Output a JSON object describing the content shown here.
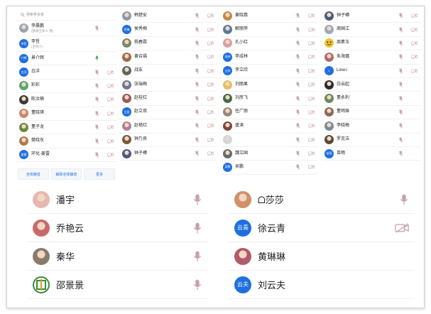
{
  "panel1": {
    "search_placeholder": "搜索参会者",
    "rows": [
      {
        "name": "李晨鹏",
        "sub": "(我将全体人 我)",
        "avatar": "photo",
        "color": "#9aa6b2",
        "badge": "",
        "mic": "muted",
        "cam": false
      },
      {
        "name": "李哲",
        "sub": "(主持人)",
        "avatar": "text",
        "color": "#1f6fe0",
        "badge": "李哲",
        "mic": "none",
        "cam": false
      },
      {
        "name": "景介辉",
        "sub": "",
        "avatar": "text",
        "color": "#1f6fe0",
        "badge": "介辉",
        "mic": "on",
        "cam": false
      },
      {
        "name": "白洋",
        "sub": "",
        "avatar": "text",
        "color": "#1f6fe0",
        "badge": "白洋",
        "mic": "muted",
        "cam": true
      },
      {
        "name": "彩彩",
        "sub": "",
        "avatar": "photo",
        "color": "#58a86b",
        "badge": "",
        "mic": "muted",
        "cam": true
      },
      {
        "name": "陈汝楠",
        "sub": "",
        "avatar": "photo",
        "color": "#3a3a3a",
        "badge": "",
        "mic": "muted",
        "cam": true
      },
      {
        "name": "董晓琪",
        "sub": "",
        "avatar": "photo",
        "color": "#c9856a",
        "badge": "",
        "mic": "muted",
        "cam": true
      },
      {
        "name": "董子龙",
        "sub": "",
        "avatar": "photo",
        "color": "#6c8a3c",
        "badge": "",
        "mic": "muted",
        "cam": true
      },
      {
        "name": "樊晓东",
        "sub": "",
        "avatar": "photo",
        "color": "#b07a4a",
        "badge": "",
        "mic": "muted",
        "cam": true
      },
      {
        "name": "环化-姜雷",
        "sub": "",
        "avatar": "text",
        "color": "#1f6fe0",
        "badge": "姜雷",
        "mic": "muted",
        "cam": true
      }
    ],
    "buttons": [
      "全体静音",
      "解除全体静音",
      "更多"
    ]
  },
  "panel2": {
    "rows": [
      {
        "name": "韩楚安",
        "avatar": "photo",
        "color": "#8f9aa8",
        "badge": ""
      },
      {
        "name": "侯秀梅",
        "avatar": "text",
        "color": "#1f6fe0",
        "badge": "秀梅"
      },
      {
        "name": "杨春霞",
        "avatar": "photo",
        "color": "#7a8a6a",
        "badge": ""
      },
      {
        "name": "黄召福",
        "avatar": "photo",
        "color": "#a06a4a",
        "badge": ""
      },
      {
        "name": "战友",
        "avatar": "photo",
        "color": "#5a6a5a",
        "badge": ""
      },
      {
        "name": "张瑞梅",
        "avatar": "photo",
        "color": "#6a7a9a",
        "badge": ""
      },
      {
        "name": "赵桂红",
        "avatar": "photo",
        "color": "#9a5a5a",
        "badge": ""
      },
      {
        "name": "赵立双",
        "avatar": "text",
        "color": "#1f6fe0",
        "badge": "立双"
      },
      {
        "name": "赵艳红",
        "avatar": "photo",
        "color": "#b0809a",
        "badge": ""
      },
      {
        "name": "钟乃良",
        "avatar": "photo",
        "color": "#7a5a3a",
        "badge": ""
      },
      {
        "name": "钟子樽",
        "avatar": "photo",
        "color": "#4a5a7a",
        "badge": ""
      }
    ]
  },
  "panel3": {
    "rows": [
      {
        "name": "黄晓惠",
        "avatar": "photo",
        "color": "#c08a4a",
        "badge": ""
      },
      {
        "name": "解丽萍",
        "avatar": "photo",
        "color": "#5a7a9a",
        "badge": ""
      },
      {
        "name": "孔小红",
        "avatar": "photo",
        "color": "#d9a0a0",
        "badge": ""
      },
      {
        "name": "李成林",
        "avatar": "text",
        "color": "#1f6fe0",
        "badge": "成林"
      },
      {
        "name": "李立欣",
        "avatar": "text",
        "color": "#1f6fe0",
        "badge": "立欣"
      },
      {
        "name": "刘丽果",
        "avatar": "photo",
        "color": "#e0c060",
        "badge": ""
      },
      {
        "name": "刘彦飞",
        "avatar": "photo",
        "color": "#4a6a4a",
        "badge": ""
      },
      {
        "name": "任广丽",
        "avatar": "photo",
        "color": "#9a8a7a",
        "badge": ""
      },
      {
        "name": "盛涛",
        "avatar": "photo",
        "color": "#7a4a3a",
        "badge": ""
      },
      {
        "name": "",
        "avatar": "photo",
        "color": "#cfd6de",
        "badge": ""
      },
      {
        "name": "魏立国",
        "avatar": "photo",
        "color": "#6a6a6a",
        "badge": ""
      },
      {
        "name": "吴鹏",
        "avatar": "text",
        "color": "#1f6fe0",
        "badge": "吴鹏"
      }
    ]
  },
  "panel4": {
    "rows": [
      {
        "name": "钟子樽",
        "avatar": "photo",
        "color": "#4a5a7a",
        "badge": "",
        "cam": true
      },
      {
        "name": "周国江",
        "avatar": "photo",
        "color": "#9aaabb",
        "badge": "",
        "cam": true
      },
      {
        "name": "周素玉",
        "avatar": "emoji",
        "color": "#f2c230",
        "badge": "",
        "cam": true
      },
      {
        "name": "朱海璐",
        "avatar": "photo",
        "color": "#b06a6a",
        "badge": "",
        "cam": true
      },
      {
        "name": "Lixw√",
        "avatar": "text",
        "color": "#1f6fe0",
        "badge": "L",
        "cam": true
      },
      {
        "name": "白云起",
        "avatar": "photo",
        "color": "#2a2a2a",
        "badge": "",
        "cam": false
      },
      {
        "name": "董永利",
        "avatar": "photo",
        "color": "#6a8a5a",
        "badge": "",
        "cam": false
      },
      {
        "name": "董明珠",
        "avatar": "photo",
        "color": "#8a6a5a",
        "badge": "",
        "cam": false
      },
      {
        "name": "李晓梅",
        "avatar": "photo",
        "color": "#7a8aa0",
        "badge": "",
        "cam": false
      },
      {
        "name": "罗克洁",
        "avatar": "photo",
        "color": "#5a4a3a",
        "badge": "",
        "cam": false
      },
      {
        "name": "苗雨",
        "avatar": "text",
        "color": "#1f6fe0",
        "badge": "苗雨",
        "cam": false
      }
    ]
  },
  "bottom_left": {
    "rows": [
      {
        "name": "潘宇",
        "avatar": "photo",
        "color": "#e7b7b0",
        "badge": ""
      },
      {
        "name": "乔艳云",
        "avatar": "photo",
        "color": "#c86a6a",
        "badge": ""
      },
      {
        "name": "秦华",
        "avatar": "photo",
        "color": "#8a7a6a",
        "badge": ""
      },
      {
        "name": "邵景景",
        "avatar": "logo",
        "color": "#3a8a3a",
        "badge": ""
      }
    ]
  },
  "bottom_right": {
    "rows": [
      {
        "name": "ᗝ莎莎",
        "avatar": "photo",
        "color": "#d0906a",
        "badge": "",
        "icon": "mic"
      },
      {
        "name": "徐云青",
        "avatar": "text",
        "color": "#1f6fe0",
        "badge": "云青",
        "icon": "cam"
      },
      {
        "name": "黄琳琳",
        "avatar": "photo",
        "color": "#b05a6a",
        "badge": "",
        "icon": "none"
      },
      {
        "name": "刘云夫",
        "avatar": "text",
        "color": "#1f6fe0",
        "badge": "云夫",
        "icon": "none"
      }
    ]
  },
  "colors": {
    "accent": "#1f6fe0",
    "muted_icon": "#c7a0a8",
    "mic_on": "#4cae5a"
  }
}
